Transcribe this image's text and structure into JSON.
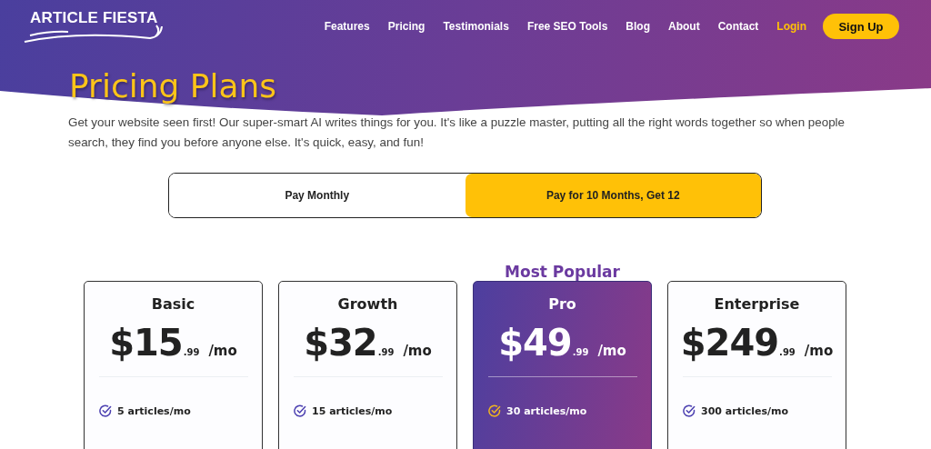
{
  "logo": {
    "text": "ARTICLE FIESTA"
  },
  "nav": [
    {
      "label": "Features",
      "kind": "link"
    },
    {
      "label": "Pricing",
      "kind": "link"
    },
    {
      "label": "Testimonials",
      "kind": "link"
    },
    {
      "label": "Free SEO Tools",
      "kind": "link"
    },
    {
      "label": "Blog",
      "kind": "link"
    },
    {
      "label": "About",
      "kind": "link"
    },
    {
      "label": "Contact",
      "kind": "link"
    },
    {
      "label": "Login",
      "kind": "login"
    },
    {
      "label": "Sign Up",
      "kind": "button"
    }
  ],
  "title": "Pricing Plans",
  "intro": "Get your website seen first! Our super-smart AI writes things for you. It's like a puzzle master, putting all the right words together so when people search, they find you before anyone else. It's quick, easy, and fun!",
  "billing_toggle": [
    {
      "label": "Pay Monthly",
      "selected": false
    },
    {
      "label": "Pay for 10 Months, Get 12",
      "selected": true
    }
  ],
  "plans": [
    {
      "name": "Basic",
      "price": "$15",
      "cents": ".99",
      "period": "/mo",
      "feature": "5 articles/mo",
      "highlighted": false
    },
    {
      "name": "Growth",
      "price": "$32",
      "cents": ".99",
      "period": "/mo",
      "feature": "15 articles/mo",
      "highlighted": false
    },
    {
      "name": "Pro",
      "badge": "Most Popular",
      "price": "$49",
      "cents": ".99",
      "period": "/mo",
      "feature": "30 articles/mo",
      "highlighted": true
    },
    {
      "name": "Enterprise",
      "price": "$249",
      "cents": ".99",
      "period": "/mo",
      "feature": "300 articles/mo",
      "highlighted": false
    }
  ]
}
